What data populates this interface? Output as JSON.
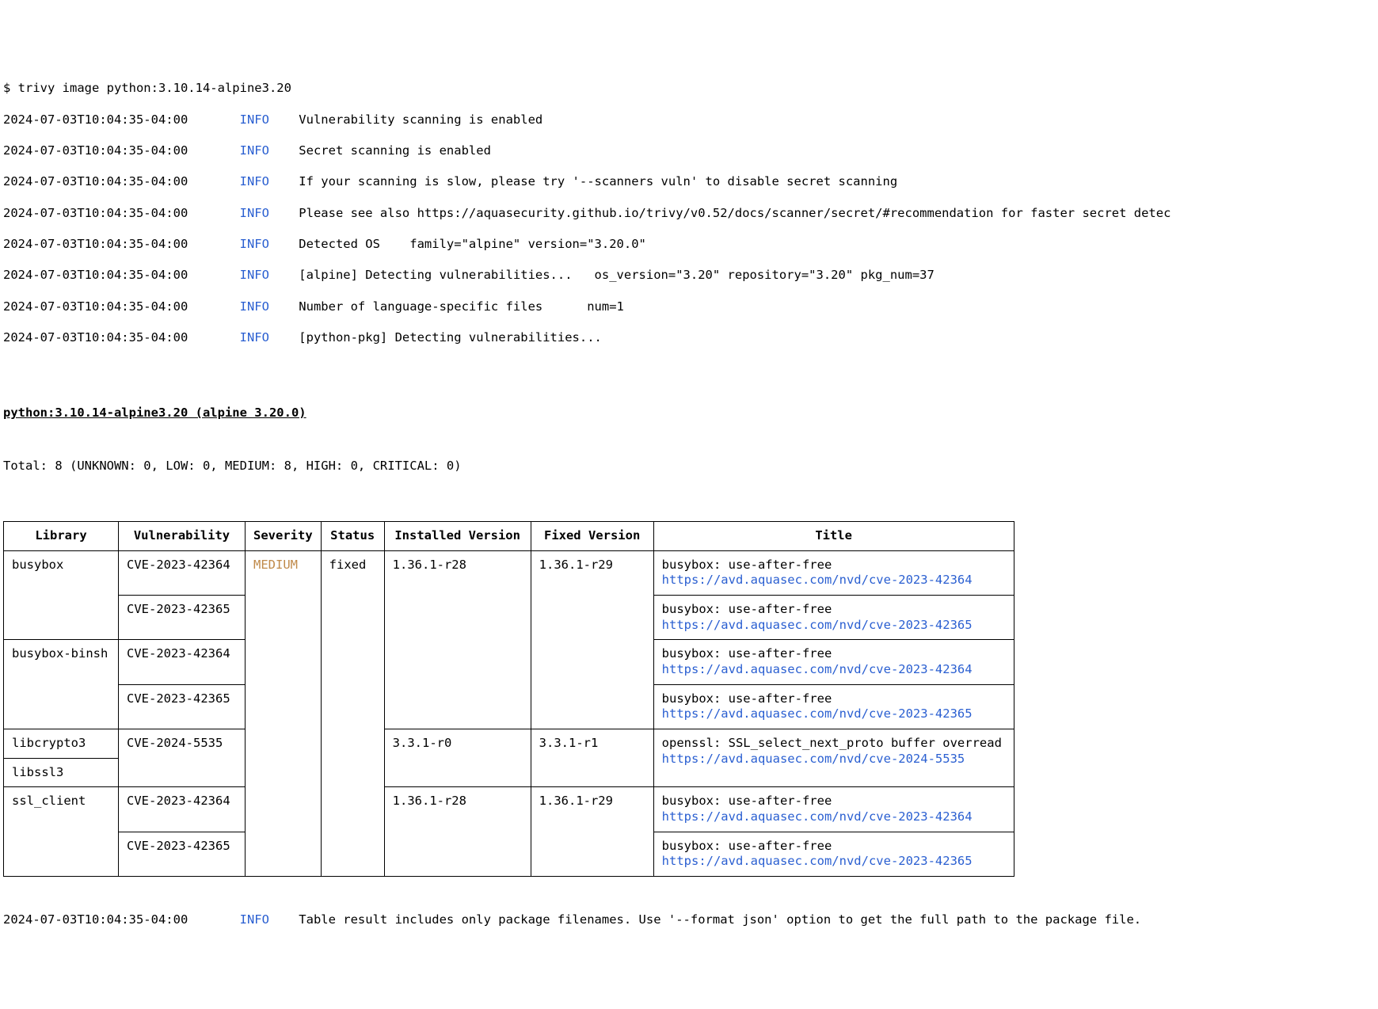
{
  "command": "$ trivy image python:3.10.14-alpine3.20",
  "log": [
    {
      "ts": "2024-07-03T10:04:35-04:00",
      "lvl": "INFO",
      "msg": "Vulnerability scanning is enabled"
    },
    {
      "ts": "2024-07-03T10:04:35-04:00",
      "lvl": "INFO",
      "msg": "Secret scanning is enabled"
    },
    {
      "ts": "2024-07-03T10:04:35-04:00",
      "lvl": "INFO",
      "msg": "If your scanning is slow, please try '--scanners vuln' to disable secret scanning"
    },
    {
      "ts": "2024-07-03T10:04:35-04:00",
      "lvl": "INFO",
      "msg": "Please see also https://aquasecurity.github.io/trivy/v0.52/docs/scanner/secret/#recommendation for faster secret detec"
    },
    {
      "ts": "2024-07-03T10:04:35-04:00",
      "lvl": "INFO",
      "msg": "Detected OS    family=\"alpine\" version=\"3.20.0\""
    },
    {
      "ts": "2024-07-03T10:04:35-04:00",
      "lvl": "INFO",
      "msg": "[alpine] Detecting vulnerabilities...   os_version=\"3.20\" repository=\"3.20\" pkg_num=37"
    },
    {
      "ts": "2024-07-03T10:04:35-04:00",
      "lvl": "INFO",
      "msg": "Number of language-specific files      num=1"
    },
    {
      "ts": "2024-07-03T10:04:35-04:00",
      "lvl": "INFO",
      "msg": "[python-pkg] Detecting vulnerabilities..."
    }
  ],
  "heading": "python:3.10.14-alpine3.20 (alpine 3.20.0)",
  "totals": "Total: 8 (UNKNOWN: 0, LOW: 0, MEDIUM: 8, HIGH: 0, CRITICAL: 0)",
  "columns": {
    "library": "Library",
    "vulnerability": "Vulnerability",
    "severity": "Severity",
    "status": "Status",
    "installed": "Installed Version",
    "fixed": "Fixed Version",
    "title": "Title"
  },
  "severity": "MEDIUM",
  "status": "fixed",
  "vulns": {
    "busybox": {
      "r1": {
        "cve": "CVE-2023-42364",
        "installed": "1.36.1-r28",
        "fixed": "1.36.1-r29",
        "title": "busybox: use-after-free",
        "link": "https://avd.aquasec.com/nvd/cve-2023-42364"
      },
      "r2": {
        "cve": "CVE-2023-42365",
        "title": "busybox: use-after-free",
        "link": "https://avd.aquasec.com/nvd/cve-2023-42365"
      }
    },
    "busybox_binsh": {
      "label": "busybox-binsh",
      "r1": {
        "cve": "CVE-2023-42364",
        "title": "busybox: use-after-free",
        "link": "https://avd.aquasec.com/nvd/cve-2023-42364"
      },
      "r2": {
        "cve": "CVE-2023-42365",
        "title": "busybox: use-after-free",
        "link": "https://avd.aquasec.com/nvd/cve-2023-42365"
      }
    },
    "libcrypto3": {
      "label": "libcrypto3",
      "r1": {
        "cve": "CVE-2024-5535",
        "installed": "3.3.1-r0",
        "fixed": "3.3.1-r1",
        "title": "openssl: SSL_select_next_proto buffer overread",
        "link": "https://avd.aquasec.com/nvd/cve-2024-5535"
      }
    },
    "libssl3": {
      "label": "libssl3"
    },
    "ssl_client": {
      "label": "ssl_client",
      "r1": {
        "cve": "CVE-2023-42364",
        "installed": "1.36.1-r28",
        "fixed": "1.36.1-r29",
        "title": "busybox: use-after-free",
        "link": "https://avd.aquasec.com/nvd/cve-2023-42364"
      },
      "r2": {
        "cve": "CVE-2023-42365",
        "title": "busybox: use-after-free",
        "link": "https://avd.aquasec.com/nvd/cve-2023-42365"
      }
    }
  },
  "busybox_label": "busybox",
  "footer": {
    "ts": "2024-07-03T10:04:35-04:00",
    "lvl": "INFO",
    "msg": "Table result includes only package filenames. Use '--format json' option to get the full path to the package file."
  }
}
